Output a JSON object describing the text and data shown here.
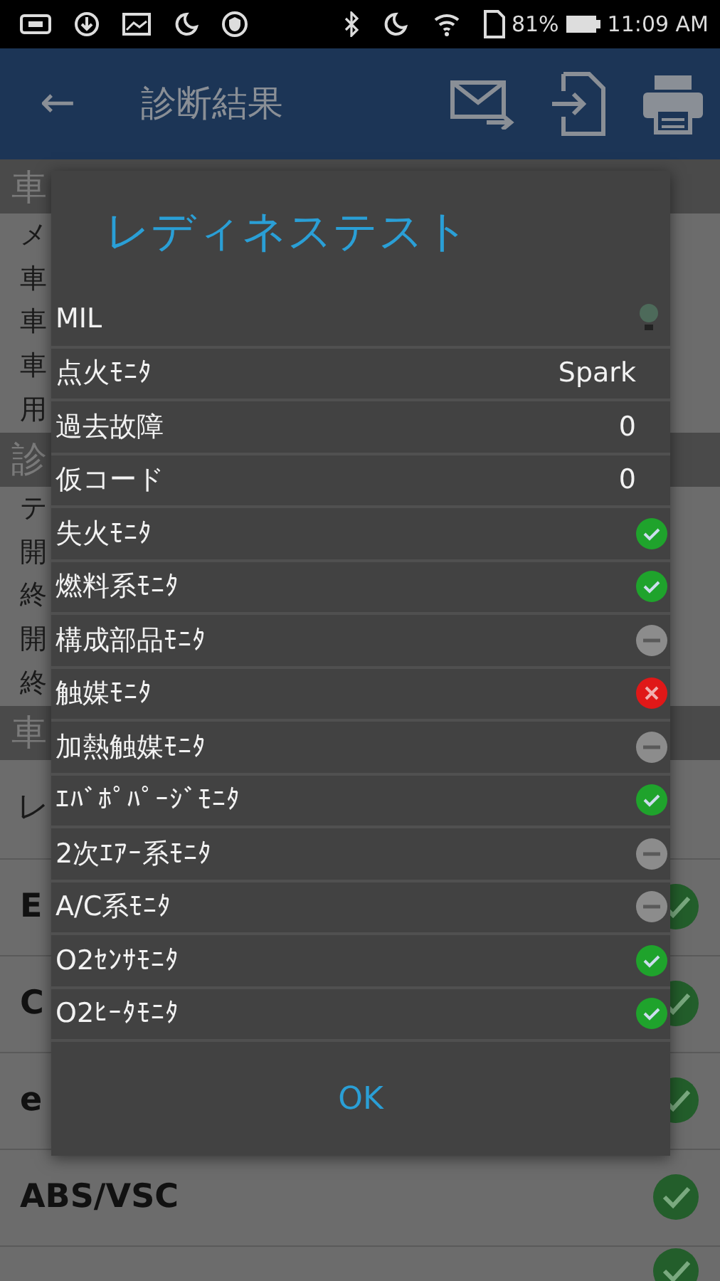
{
  "status_bar": {
    "battery": "81%",
    "time": "11:09 AM"
  },
  "app_bar": {
    "back": "←",
    "title": "診断結果"
  },
  "background": [
    {
      "kind": "header",
      "text": "車"
    },
    {
      "kind": "item",
      "text": "メ"
    },
    {
      "kind": "item",
      "text": "車"
    },
    {
      "kind": "item",
      "text": "車"
    },
    {
      "kind": "item",
      "text": "車"
    },
    {
      "kind": "item",
      "text": "用"
    },
    {
      "kind": "header",
      "text": "診"
    },
    {
      "kind": "item",
      "text": "テ"
    },
    {
      "kind": "item",
      "text": "開"
    },
    {
      "kind": "item",
      "text": "終"
    },
    {
      "kind": "item",
      "text": "開"
    },
    {
      "kind": "item",
      "text": "終"
    },
    {
      "kind": "header",
      "text": "車"
    },
    {
      "kind": "test",
      "text": "レ"
    },
    {
      "kind": "system",
      "text": "E",
      "checked": true
    },
    {
      "kind": "system",
      "text": "C",
      "checked": true
    },
    {
      "kind": "system",
      "text": "e",
      "checked": true
    },
    {
      "kind": "system",
      "text": "ABS/VSC",
      "checked": true
    },
    {
      "kind": "system",
      "checked": true
    }
  ],
  "dialog": {
    "title": "レディネステスト",
    "ok": "OK",
    "rows": [
      {
        "kind": "lamp",
        "label": "MIL",
        "on": false
      },
      {
        "kind": "value",
        "label": "点火ﾓﾆﾀ",
        "value": "Spark"
      },
      {
        "kind": "value",
        "label": "過去故障",
        "value": "0"
      },
      {
        "kind": "value",
        "label": "仮コード",
        "value": "0"
      },
      {
        "kind": "complete",
        "label": "失火ﾓﾆﾀ"
      },
      {
        "kind": "complete",
        "label": "燃料系ﾓﾆﾀ"
      },
      {
        "kind": "unsupported",
        "label": "構成部品ﾓﾆﾀ"
      },
      {
        "kind": "incomplete",
        "label": "触媒ﾓﾆﾀ"
      },
      {
        "kind": "unsupported",
        "label": "加熱触媒ﾓﾆﾀ"
      },
      {
        "kind": "complete",
        "label": "ｴﾊﾞﾎﾟﾊﾟｰｼﾞﾓﾆﾀ"
      },
      {
        "kind": "unsupported",
        "label": "2次ｴｱｰ系ﾓﾆﾀ"
      },
      {
        "kind": "unsupported",
        "label": "A/C系ﾓﾆﾀ"
      },
      {
        "kind": "complete",
        "label": "O2ｾﾝｻﾓﾆﾀ"
      },
      {
        "kind": "complete",
        "label": "O2ﾋｰﾀﾓﾆﾀ"
      }
    ]
  }
}
